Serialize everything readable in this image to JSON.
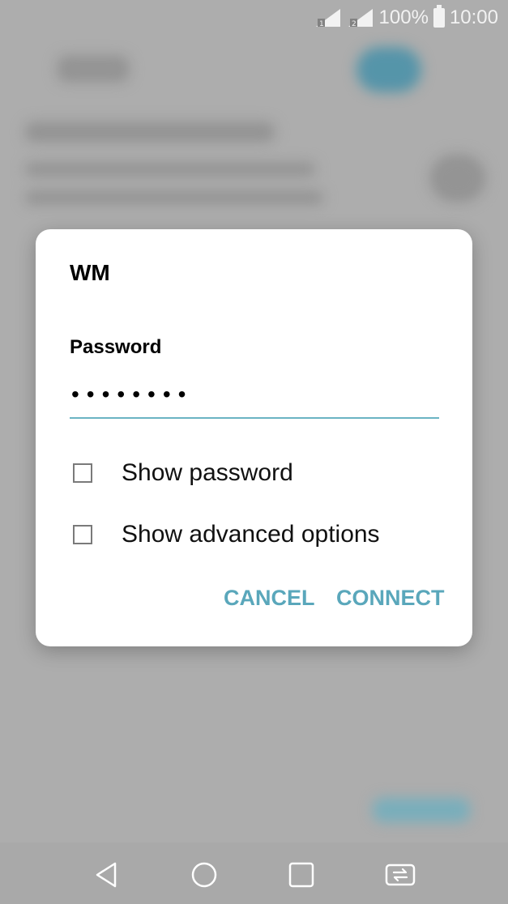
{
  "status_bar": {
    "battery_percent": "100%",
    "time": "10:00",
    "icons": [
      "sim1-signal-icon",
      "sim2-signal-icon",
      "battery-icon"
    ]
  },
  "dialog": {
    "title": "WM",
    "password_label": "Password",
    "password_value": "••••••••",
    "show_password_label": "Show password",
    "show_password_checked": false,
    "show_advanced_label": "Show advanced options",
    "show_advanced_checked": false,
    "cancel_label": "CANCEL",
    "connect_label": "CONNECT"
  },
  "nav_bar": {
    "icons": [
      "back-icon",
      "home-icon",
      "recents-icon",
      "dual-window-icon"
    ]
  },
  "colors": {
    "accent": "#5aa7bb",
    "field_underline": "#6bb4c3",
    "scrim_background": "#b7b7b7"
  }
}
